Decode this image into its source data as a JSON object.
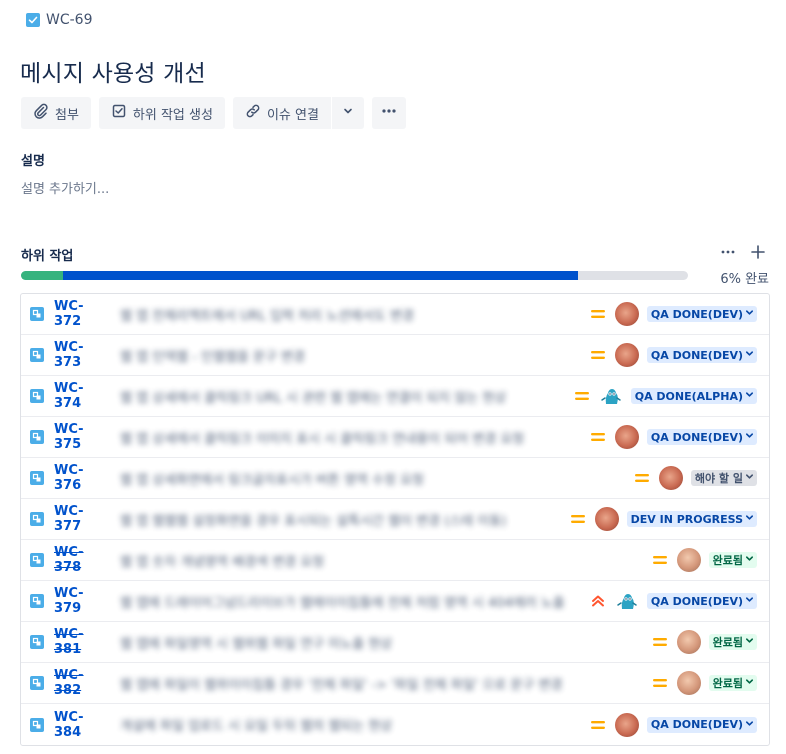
{
  "issue": {
    "key": "WC-69",
    "title": "메시지 사용성 개선"
  },
  "toolbar": {
    "attach_label": "첨부",
    "create_subtask_label": "하위 작업 생성",
    "link_issue_label": "이슈 연결"
  },
  "description": {
    "heading": "설명",
    "placeholder": "설명 추가하기..."
  },
  "subtasks": {
    "heading": "하위 작업",
    "progress_label": "6% 완료",
    "progress_done_fraction": 0.063,
    "progress_in_progress_fraction": 0.772,
    "items": [
      {
        "key": "WC-372",
        "summary": "웹 앱 전체리엑트에서 URL 입력 처리 노션에서도 변경",
        "done": false,
        "priority": "medium",
        "avatar": "a1",
        "status": "QA DONE(DEV)",
        "status_color": "blue"
      },
      {
        "key": "WC-373",
        "summary": "웹 앱 인덱웹 - 인웹웹을 문구 변경",
        "done": false,
        "priority": "medium",
        "avatar": "a1",
        "status": "QA DONE(DEV)",
        "status_color": "blue"
      },
      {
        "key": "WC-374",
        "summary": "웹 앱 상세에서 클릭링크 URL 시 관련 웹 앱에는 연결이 되지 않는 현상",
        "done": false,
        "priority": "medium",
        "avatar": "a2",
        "status": "QA DONE(ALPHA)",
        "status_color": "blue"
      },
      {
        "key": "WC-375",
        "summary": "웹 앱 상세에서 클릭링크 이미지 표시 시 클릭링크 연내용이 되어 변경 요청",
        "done": false,
        "priority": "medium",
        "avatar": "a1",
        "status": "QA DONE(DEV)",
        "status_color": "blue"
      },
      {
        "key": "WC-376",
        "summary": "웹 앱 상세화면에서 링크글자표시가 버튼 영역 수정 요청",
        "done": false,
        "priority": "medium",
        "avatar": "a1",
        "status": "해야 할 일",
        "status_color": "gray"
      },
      {
        "key": "WC-377",
        "summary": "웹 앱 웹웹웹 설정화면을 경우 표시되는 설특시간 웹이 변경 (스테 이동)",
        "done": false,
        "priority": "medium",
        "avatar": "a1",
        "status": "DEV IN PROGRESS",
        "status_color": "blue"
      },
      {
        "key": "WC-378",
        "summary": "웹 앱 숫자 개념영역 배경색 변경 요청",
        "done": true,
        "priority": "medium",
        "avatar": "a3",
        "status": "완료됨",
        "status_color": "green"
      },
      {
        "key": "WC-379",
        "summary": "웹 앱에 드래이어그넘드리이브가 웹에이이칩틀에 전체 처럼 영역 시 404에러 노출",
        "done": false,
        "priority": "highest",
        "avatar": "a2",
        "status": "QA DONE(DEV)",
        "status_color": "blue"
      },
      {
        "key": "WC-381",
        "summary": "웹 앱에 파일영역 시 웹위웹 파일 연구 미노출 현상",
        "done": true,
        "priority": "medium",
        "avatar": "a3",
        "status": "완료됨",
        "status_color": "green"
      },
      {
        "key": "WC-382",
        "summary": "웹 앱에 파일이 웹위이이칩틀 경우 '전체 파일' -> '파일 전체 파일' 으로 문구 변경",
        "done": true,
        "priority": "medium",
        "avatar": "a3",
        "status": "완료됨",
        "status_color": "green"
      },
      {
        "key": "WC-384",
        "summary": "개설에 파일 업로드 시 요일 두뒤 웹의 웹되는 현상",
        "done": false,
        "priority": "medium",
        "avatar": "a1",
        "status": "QA DONE(DEV)",
        "status_color": "blue"
      }
    ]
  },
  "colors": {
    "accent": "#0052CC",
    "progress_done": "#36B37E",
    "priority_medium": "#FFAB00",
    "priority_highest": "#FF5630"
  }
}
